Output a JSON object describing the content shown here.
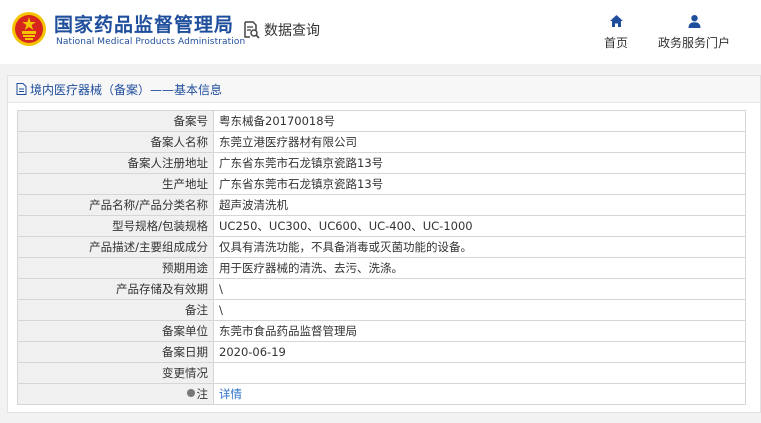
{
  "header": {
    "brand_cn": "国家药品监督管理局",
    "brand_en": "National Medical Products Administration",
    "logo_icon": "emblem-icon",
    "query_label": "数据查询",
    "query_icon": "document-search-icon",
    "nav": [
      {
        "label": "首页",
        "icon": "home-icon"
      },
      {
        "label": "政务服务门户",
        "icon": "user-icon"
      }
    ]
  },
  "panel": {
    "title": "境内医疗器械（备案）——基本信息",
    "title_icon": "document-icon"
  },
  "records": [
    {
      "label": "备案号",
      "value": "粤东械备20170018号"
    },
    {
      "label": "备案人名称",
      "value": "东莞立港医疗器材有限公司"
    },
    {
      "label": "备案人注册地址",
      "value": "广东省东莞市石龙镇京瓷路13号"
    },
    {
      "label": "生产地址",
      "value": "广东省东莞市石龙镇京瓷路13号"
    },
    {
      "label": "产品名称/产品分类名称",
      "value": "超声波清洗机"
    },
    {
      "label": "型号规格/包装规格",
      "value": "UC250、UC300、UC600、UC-400、UC-1000"
    },
    {
      "label": "产品描述/主要组成成分",
      "value": "仅具有清洗功能，不具备消毒或灭菌功能的设备。"
    },
    {
      "label": "预期用途",
      "value": "用于医疗器械的清洗、去污、洗涤。"
    },
    {
      "label": "产品存储及有效期",
      "value": "\\"
    },
    {
      "label": "备注",
      "value": "\\"
    },
    {
      "label": "备案单位",
      "value": "东莞市食品药品监督管理局"
    },
    {
      "label": "备案日期",
      "value": "2020-06-19"
    },
    {
      "label": "变更情况",
      "value": ""
    },
    {
      "label": "注",
      "value": "详情"
    }
  ],
  "colors": {
    "brand": "#1f4e9c",
    "link": "#2a6fc9",
    "emblem_red": "#d7261e",
    "emblem_gold": "#f5c400"
  }
}
